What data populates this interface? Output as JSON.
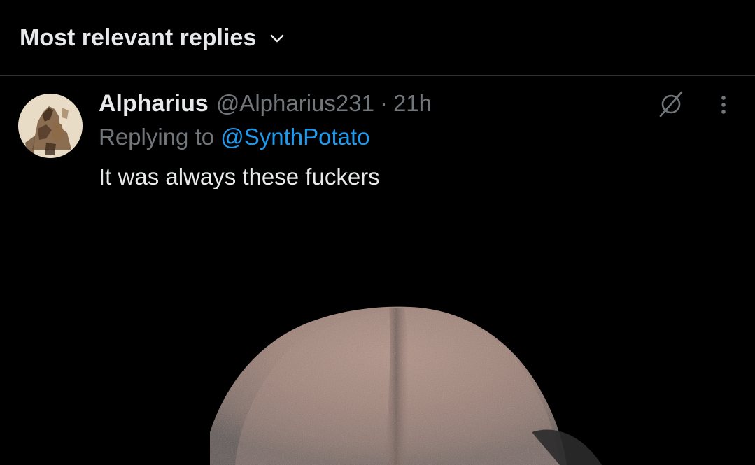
{
  "sort": {
    "label": "Most relevant replies",
    "icon": "chevron-down-icon"
  },
  "reply": {
    "author": {
      "display_name": "Alpharius",
      "handle": "@Alpharius231",
      "avatar": "avatar-image"
    },
    "separator": "·",
    "time": "21h",
    "replying_prefix": "Replying to ",
    "replying_to": "@SynthPotato",
    "text": "It was always these fuckers",
    "actions": {
      "grok_icon": "grok-icon",
      "more_icon": "more-vertical-icon"
    },
    "media": "attached-image"
  },
  "colors": {
    "background": "#000000",
    "text_primary": "#e7e9ea",
    "text_secondary": "#71767b",
    "accent": "#1d9bf0",
    "divider": "#2f3336"
  }
}
